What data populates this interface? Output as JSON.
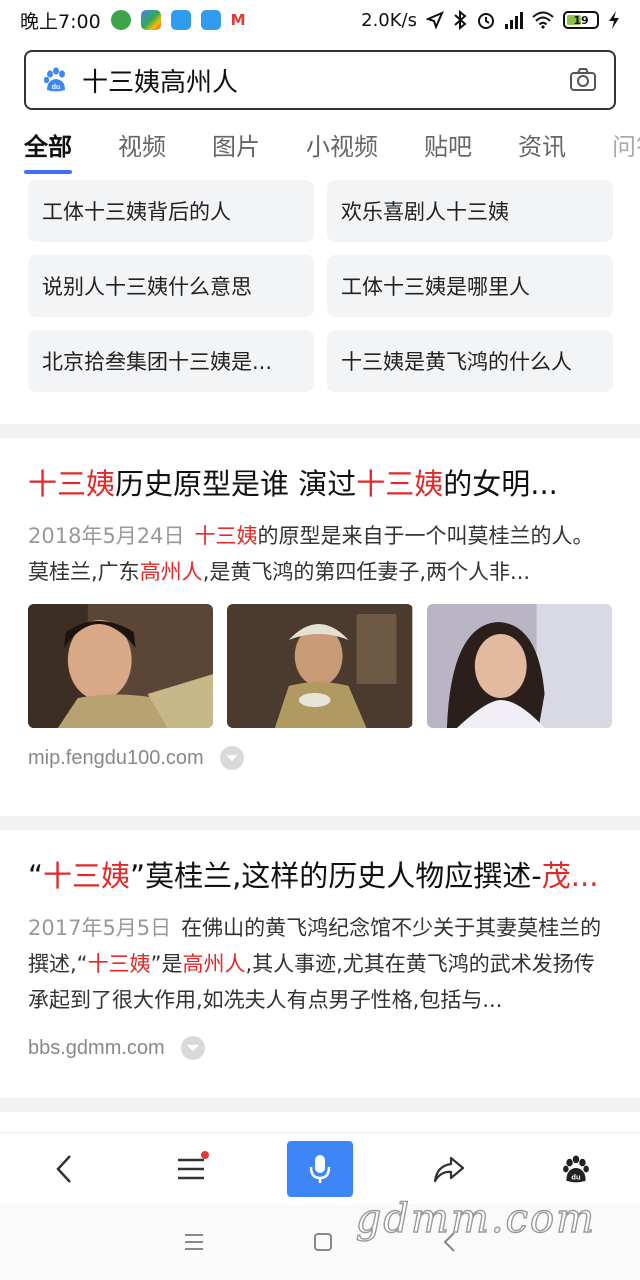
{
  "status": {
    "time": "晚上7:00",
    "speed": "2.0K/s",
    "battery": "19",
    "network": "HD"
  },
  "search": {
    "query": "十三姨高州人"
  },
  "tabs": [
    "全部",
    "视频",
    "图片",
    "小视频",
    "贴吧",
    "资讯",
    "问答"
  ],
  "related": [
    "工体十三姨背后的人",
    "欢乐喜剧人十三姨",
    "说别人十三姨什么意思",
    "工体十三姨是哪里人",
    "北京拾叁集团十三姨是...",
    "十三姨是黄飞鸿的什么人"
  ],
  "results": [
    {
      "title_hl1": "十三姨",
      "title_mid": "历史原型是谁 演过",
      "title_hl2": "十三姨",
      "title_end": "的女明...",
      "date": "2018年5月24日",
      "snip_hl1": "十三姨",
      "snip_a": "的原型是来自于一个叫莫桂兰的人。莫桂兰,广东",
      "snip_hl2": "高州人",
      "snip_b": ",是黄飞鸿的第四任妻子,两个人非...",
      "source": "mip.fengdu100.com"
    },
    {
      "title_q1": "“",
      "title_hl1": "十三姨",
      "title_mid": "”莫桂兰,这样的历史人物应撰述-",
      "title_hl2": "茂...",
      "date": "2017年5月5日",
      "snip_a": "在佛山的黄飞鸿纪念馆不少关于其妻莫桂兰的撰述,“",
      "snip_hl1": "十三姨",
      "snip_b": "”是",
      "snip_hl2": "高州人",
      "snip_c": ",其人事迹,尤其在黄飞鸿的武术发扬传承起到了很大作用,如冼夫人有点男子性格,包括与...",
      "source": "bbs.gdmm.com"
    }
  ],
  "watermark": "gdmm.com",
  "colors": {
    "highlight": "#e02a2a",
    "accent": "#3e6ff7",
    "voice": "#3e86f7"
  }
}
